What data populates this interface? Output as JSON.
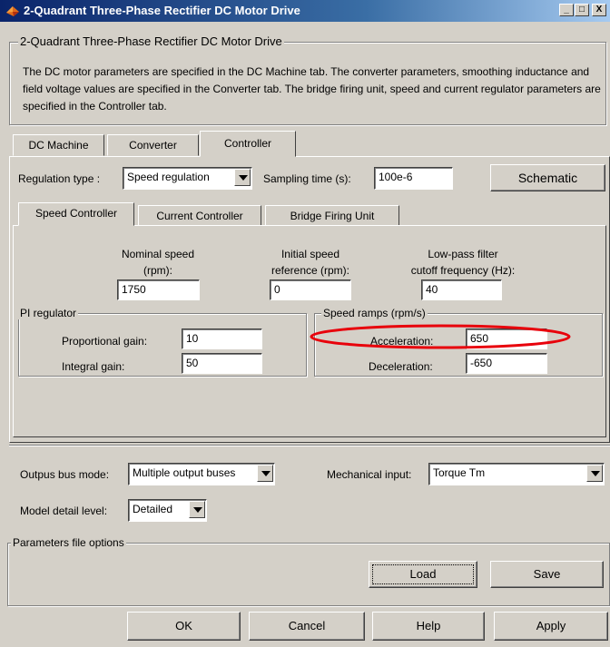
{
  "window": {
    "title": "2-Quadrant Three-Phase Rectifier DC Motor Drive",
    "icon": "matlab-icon",
    "controls": [
      "_",
      "□",
      "X"
    ]
  },
  "block": {
    "group_title": "2-Quadrant Three-Phase Rectifier DC Motor Drive",
    "description": "The DC motor parameters are specified in the DC Machine tab. The converter parameters, smoothing inductance and field voltage values are specified in the Converter tab. The bridge firing unit, speed and current regulator parameters are specified in the Controller tab."
  },
  "main_tabs": [
    {
      "label": "DC Machine",
      "active": false
    },
    {
      "label": "Converter",
      "active": false
    },
    {
      "label": "Controller",
      "active": true
    }
  ],
  "controller": {
    "regulation_type_label": "Regulation type :",
    "regulation_type_value": "Speed regulation",
    "sampling_time_label": "Sampling time (s):",
    "sampling_time_value": "100e-6",
    "schematic_button": "Schematic"
  },
  "sub_tabs": [
    {
      "label": "Speed Controller",
      "active": true
    },
    {
      "label": "Current Controller",
      "active": false
    },
    {
      "label": "Bridge Firing Unit",
      "active": false
    }
  ],
  "speed_controller": {
    "nominal_speed_label_1": "Nominal speed",
    "nominal_speed_label_2": "(rpm):",
    "nominal_speed_value": "1750",
    "initial_speed_label_1": "Initial speed",
    "initial_speed_label_2": "reference (rpm):",
    "initial_speed_value": "0",
    "lowpass_label_1": "Low-pass filter",
    "lowpass_label_2": "cutoff frequency (Hz):",
    "lowpass_value": "40",
    "pi_group": "PI regulator",
    "proportional_gain_label": "Proportional gain:",
    "proportional_gain_value": "10",
    "integral_gain_label": "Integral gain:",
    "integral_gain_value": "50",
    "ramps_group": "Speed ramps (rpm/s)",
    "acceleration_label": "Acceleration:",
    "acceleration_value": "650",
    "deceleration_label": "Deceleration:",
    "deceleration_value": "-650",
    "highlight_color": "#e8000b"
  },
  "outputs": {
    "bus_mode_label": "Outpus bus mode:",
    "bus_mode_value": "Multiple output buses",
    "mechanical_input_label": "Mechanical input:",
    "mechanical_input_value": "Torque Tm",
    "model_detail_label": "Model detail level:",
    "model_detail_value": "Detailed"
  },
  "params_file": {
    "group_title": "Parameters file options",
    "load_button": "Load",
    "save_button": "Save"
  },
  "footer": {
    "ok": "OK",
    "cancel": "Cancel",
    "help": "Help",
    "apply": "Apply"
  }
}
